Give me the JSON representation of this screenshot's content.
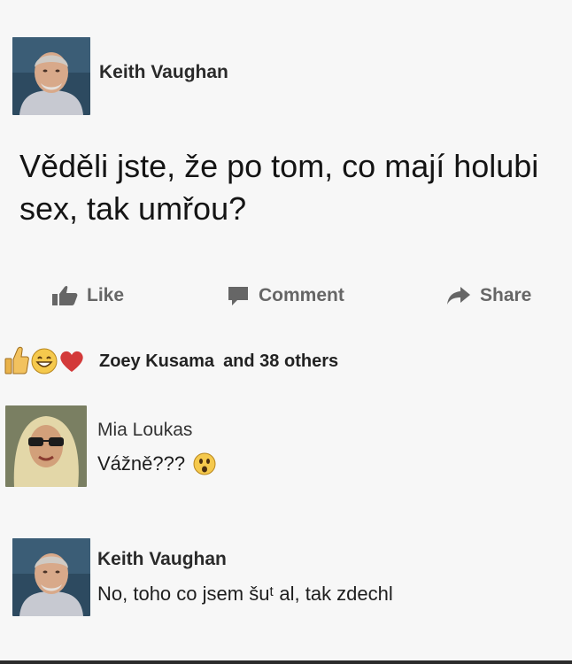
{
  "post": {
    "author": "Keith Vaughan",
    "text": "Věděli jste, že po tom, co mají holubi sex, tak umřou?",
    "avatar_icon": "man-portrait-avatar"
  },
  "actions": {
    "like_label": "Like",
    "comment_label": "Comment",
    "share_label": "Share"
  },
  "reactions": {
    "icons": [
      "thumbs-up-icon",
      "smiley-face-icon",
      "heart-icon"
    ],
    "name": "Zoey Kusama",
    "others": "and 38 others"
  },
  "comments": [
    {
      "author": "Mia Loukas",
      "text": "Vážně???",
      "emoji": "surprised-face-icon",
      "avatar_icon": "woman-portrait-avatar"
    },
    {
      "author": "Keith Vaughan",
      "text": "No, toho co jsem šuᵗ al, tak zdechl",
      "avatar_icon": "man-portrait-avatar"
    }
  ],
  "colors": {
    "background": "#f7f7f7",
    "action_gray": "#666666",
    "heart_red": "#d33a3a",
    "thumb_yellow": "#e9b24a"
  }
}
